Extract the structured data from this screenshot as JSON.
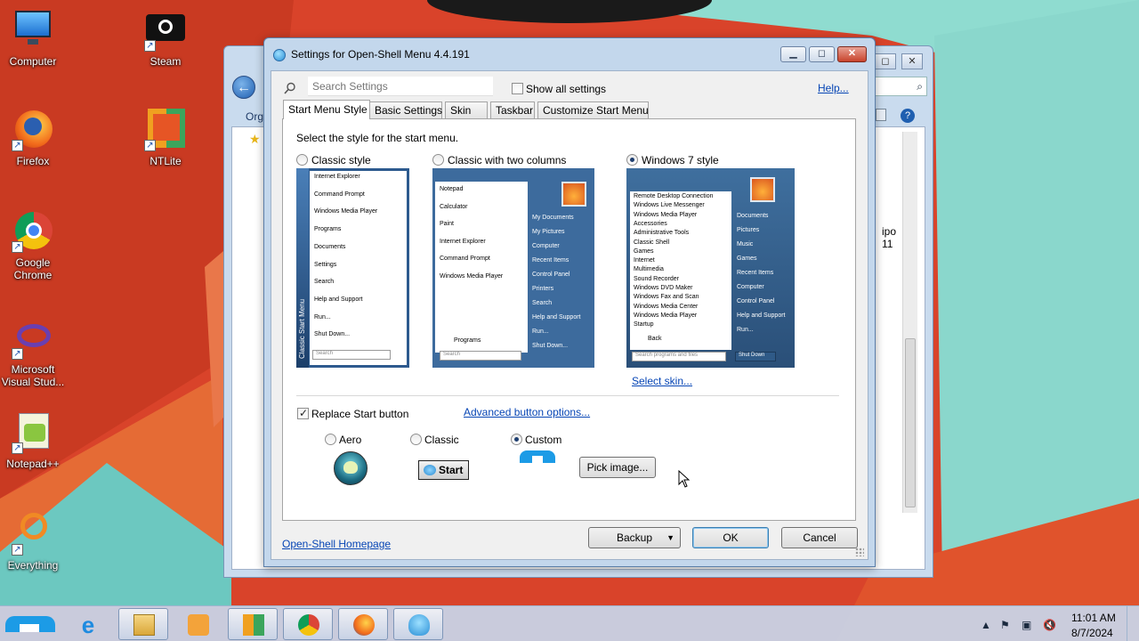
{
  "desktop": {
    "icons": [
      {
        "label": "Computer",
        "icon": "computer-icon"
      },
      {
        "label": "Steam",
        "icon": "steam-icon"
      },
      {
        "label": "Firefox",
        "icon": "firefox-icon"
      },
      {
        "label": "NTLite",
        "icon": "ntlite-icon"
      },
      {
        "label": "Google Chrome",
        "icon": "chrome-icon"
      },
      {
        "label": "Microsoft Visual Stud...",
        "icon": "visual-studio-icon"
      },
      {
        "label": "Notepad++",
        "icon": "notepadpp-icon"
      },
      {
        "label": "Everything",
        "icon": "everything-icon"
      }
    ]
  },
  "background_window": {
    "org_label": "Org",
    "right_text_1": "ipo",
    "right_text_2": "11"
  },
  "dialog": {
    "title": "Settings for Open-Shell Menu 4.4.191",
    "search_placeholder": "Search Settings",
    "show_all_label": "Show all settings",
    "help_link": "Help...",
    "tabs": [
      {
        "label": "Start Menu Style",
        "active": true
      },
      {
        "label": "Basic Settings",
        "active": false
      },
      {
        "label": "Skin",
        "active": false
      },
      {
        "label": "Taskbar",
        "active": false
      },
      {
        "label": "Customize Start Menu",
        "active": false
      }
    ],
    "select_label": "Select the style for the start menu.",
    "styles": [
      {
        "label": "Classic style",
        "selected": false
      },
      {
        "label": "Classic with two columns",
        "selected": false
      },
      {
        "label": "Windows 7 style",
        "selected": true
      }
    ],
    "preview_classic": {
      "items": [
        "Internet Explorer",
        "Command Prompt",
        "Windows Media Player",
        "Programs",
        "Documents",
        "Settings",
        "Search",
        "Help and Support",
        "Run...",
        "Shut Down..."
      ],
      "side_label": "Classic Start Menu",
      "search": "Search"
    },
    "preview_two_col": {
      "left_items": [
        "Notepad",
        "Calculator",
        "Paint",
        "Internet Explorer",
        "Command Prompt",
        "Windows Media Player"
      ],
      "programs": "Programs",
      "right_items": [
        "My Documents",
        "My Pictures",
        "Computer",
        "Recent Items",
        "Control Panel",
        "Printers",
        "Search",
        "Help and Support",
        "Run...",
        "Shut Down..."
      ],
      "search": "Search"
    },
    "preview_win7": {
      "left_items": [
        "Remote Desktop Connection",
        "Windows Live Messenger",
        "Windows Media Player",
        "Accessories",
        "Administrative Tools",
        "Classic Shell",
        "Games",
        "Internet",
        "Multimedia",
        "Sound Recorder",
        "Windows DVD Maker",
        "Windows Fax and Scan",
        "Windows Media Center",
        "Windows Media Player",
        "Startup"
      ],
      "back": "Back",
      "right_items": [
        "Documents",
        "Pictures",
        "Music",
        "Games",
        "Recent Items",
        "Computer",
        "Control Panel",
        "Help and Support",
        "Run..."
      ],
      "search": "Search programs and files",
      "shutdown": "Shut Down"
    },
    "select_skin_link": "Select skin...",
    "replace_start_label": "Replace Start button",
    "replace_start_checked": true,
    "advanced_link": "Advanced button options...",
    "button_styles": [
      {
        "label": "Aero",
        "selected": false
      },
      {
        "label": "Classic",
        "selected": false
      },
      {
        "label": "Custom",
        "selected": true
      }
    ],
    "classic_button_text": "Start",
    "pick_image_label": "Pick image...",
    "homepage_link": "Open-Shell Homepage",
    "backup_label": "Backup",
    "ok_label": "OK",
    "cancel_label": "Cancel"
  },
  "taskbar": {
    "apps": [
      "internet-explorer-icon",
      "file-explorer-icon",
      "media-player-icon",
      "ntlite-icon",
      "chrome-icon",
      "firefox-icon",
      "open-shell-icon"
    ],
    "time": "11:01 AM",
    "date": "8/7/2024"
  }
}
